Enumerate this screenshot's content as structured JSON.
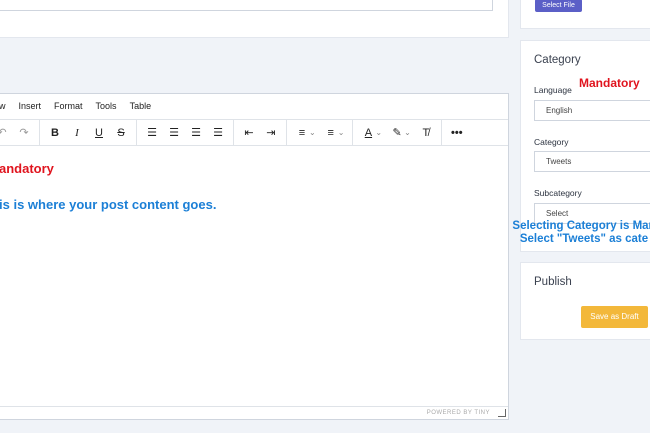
{
  "editor": {
    "menu": [
      "ew",
      "Insert",
      "Format",
      "Tools",
      "Table"
    ],
    "content_mandatory": "andatory",
    "content_note": "is is where your post content goes.",
    "status": "POWERED BY TINY"
  },
  "upload": {
    "select_file": "Select File"
  },
  "category": {
    "title": "Category",
    "language_label": "Language",
    "language_value": "English",
    "language_mandatory": "Mandatory",
    "category_label": "Category",
    "category_value": "Tweets",
    "subcategory_label": "Subcategory",
    "subcategory_value": "Select",
    "note_line1": "Selecting Category is Man",
    "note_line2": "Select \"Tweets\" as cate"
  },
  "publish": {
    "title": "Publish",
    "save_draft": "Save as Draft"
  }
}
